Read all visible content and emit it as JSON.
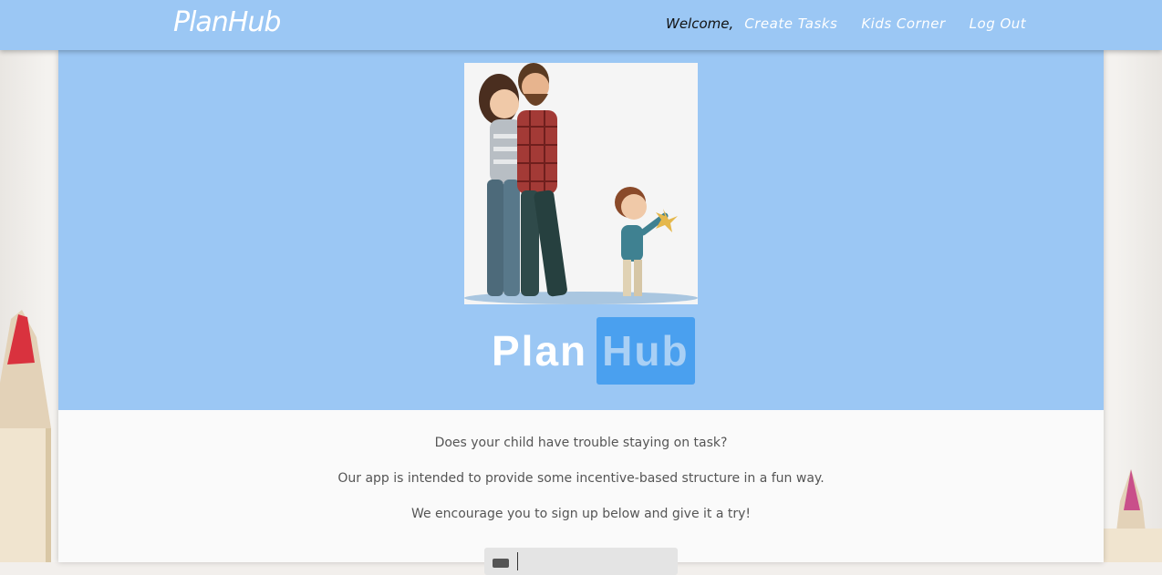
{
  "nav": {
    "brand": "PlanHub",
    "welcome": "Welcome,",
    "links": [
      "Create Tasks",
      "Kids Corner",
      "Log Out"
    ]
  },
  "hero": {
    "logo_plan": "Plan",
    "logo_hub": "Hub"
  },
  "intro": {
    "line1": "Does your child have trouble staying on task?",
    "line2": "Our app is intended to provide some incentive-based structure in a fun way.",
    "line3": "We encourage you to sign up below and give it a try!"
  },
  "colors": {
    "nav_bg": "#9bc7f4",
    "hub_highlight": "#4aa0ef"
  }
}
